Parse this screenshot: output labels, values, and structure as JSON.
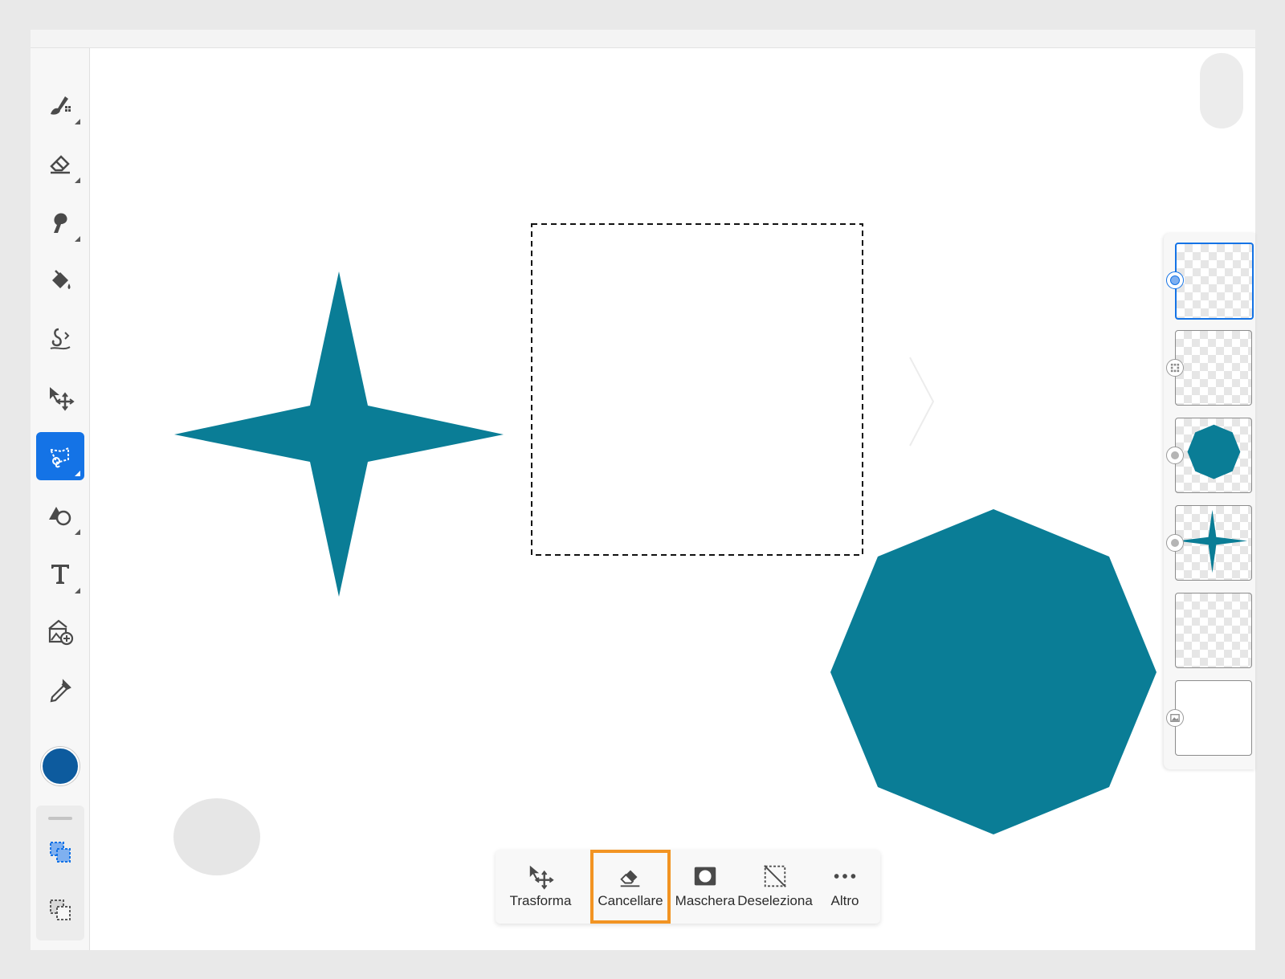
{
  "toolbar": {
    "tools": [
      {
        "name": "brush-tool",
        "icon": "brush-icon"
      },
      {
        "name": "eraser-tool",
        "icon": "eraser-icon"
      },
      {
        "name": "smudge-tool",
        "icon": "smudge-icon"
      },
      {
        "name": "fill-tool",
        "icon": "paint-bucket-icon"
      },
      {
        "name": "healing-tool",
        "icon": "healing-icon"
      },
      {
        "name": "move-tool",
        "icon": "move-icon"
      },
      {
        "name": "lasso-select-tool",
        "icon": "lasso-select-icon",
        "active": true
      },
      {
        "name": "shapes-tool",
        "icon": "shapes-icon"
      },
      {
        "name": "text-tool",
        "icon": "text-icon"
      },
      {
        "name": "place-image-tool",
        "icon": "place-image-icon"
      },
      {
        "name": "eyedropper-tool",
        "icon": "eyedropper-icon"
      }
    ],
    "color": "#0d5b9e",
    "sub_tools": [
      {
        "name": "add-selection",
        "icon": "add-selection-icon"
      },
      {
        "name": "subtract-selection",
        "icon": "subtract-selection-icon"
      }
    ]
  },
  "canvas": {
    "shape_color": "#0a7d96",
    "shapes": [
      "four-point-star",
      "octagon"
    ],
    "selection": "rectangular-marquee"
  },
  "layers": {
    "items": [
      {
        "name": "layer-1",
        "content": "empty",
        "selected": true,
        "badge": "selected-dot"
      },
      {
        "name": "layer-2",
        "content": "empty",
        "badge": "pixel-layer-icon"
      },
      {
        "name": "layer-3",
        "content": "octagon",
        "badge": "dot"
      },
      {
        "name": "layer-4",
        "content": "star",
        "badge": "dot"
      },
      {
        "name": "layer-5",
        "content": "empty"
      },
      {
        "name": "layer-6",
        "content": "white-background",
        "badge": "image-layer-icon"
      }
    ]
  },
  "context_bar": {
    "items": [
      {
        "label": "Trasforma",
        "icon": "transform-icon"
      },
      {
        "label": "Cancellare",
        "icon": "eraser-icon",
        "highlighted": true
      },
      {
        "label": "Maschera",
        "icon": "mask-icon"
      },
      {
        "label": "Deseleziona",
        "icon": "deselect-icon"
      },
      {
        "label": "Altro",
        "icon": "more-icon"
      }
    ],
    "highlight_color": "#f29423"
  }
}
